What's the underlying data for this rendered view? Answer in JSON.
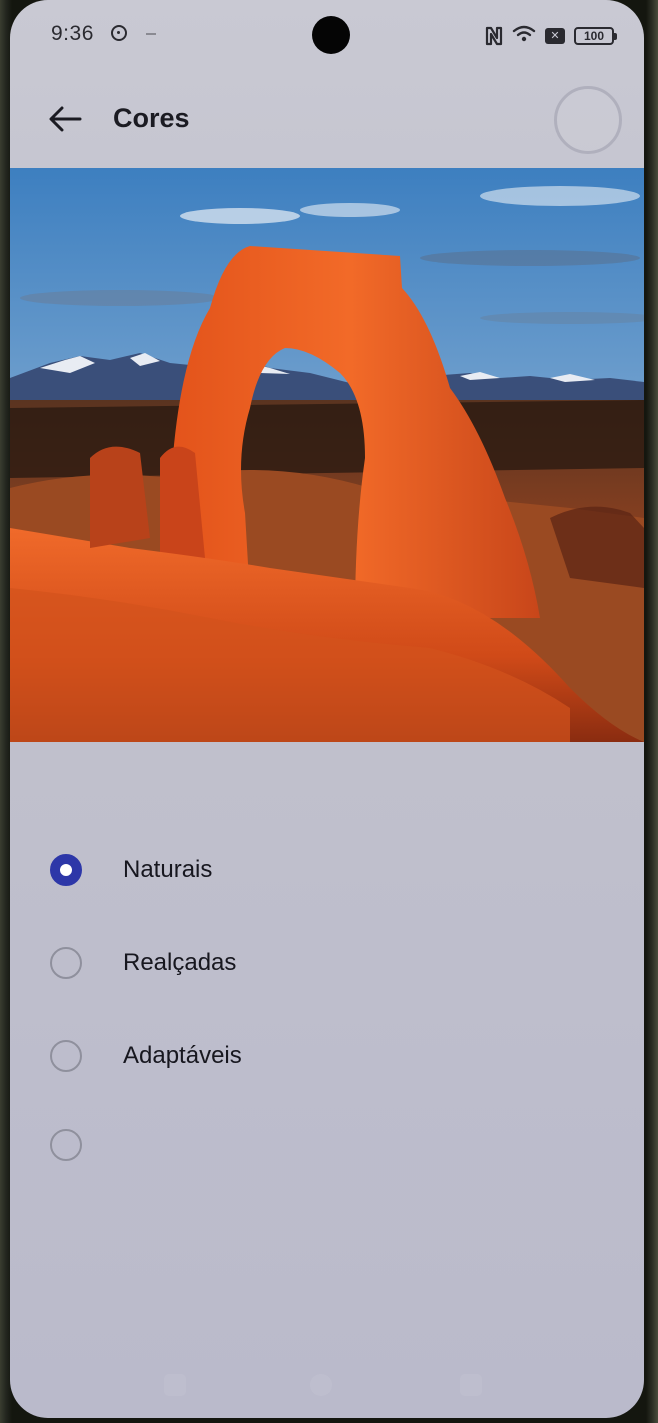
{
  "status_bar": {
    "time": "9:36",
    "battery": "100",
    "icons": [
      "settings-icon",
      "nfc-icon",
      "wifi-icon",
      "mute-icon",
      "battery-icon"
    ]
  },
  "header": {
    "title": "Cores",
    "back_icon": "back-arrow-icon"
  },
  "preview": {
    "type": "wallpaper-photo"
  },
  "options": [
    {
      "label": "Naturais",
      "selected": true
    },
    {
      "label": "Realçadas",
      "selected": false
    },
    {
      "label": "Adaptáveis",
      "selected": false
    },
    {
      "label": "",
      "selected": false
    }
  ],
  "colors": {
    "accent": "#2d37a8",
    "background": "#c4c4cf",
    "text": "#17171f"
  }
}
